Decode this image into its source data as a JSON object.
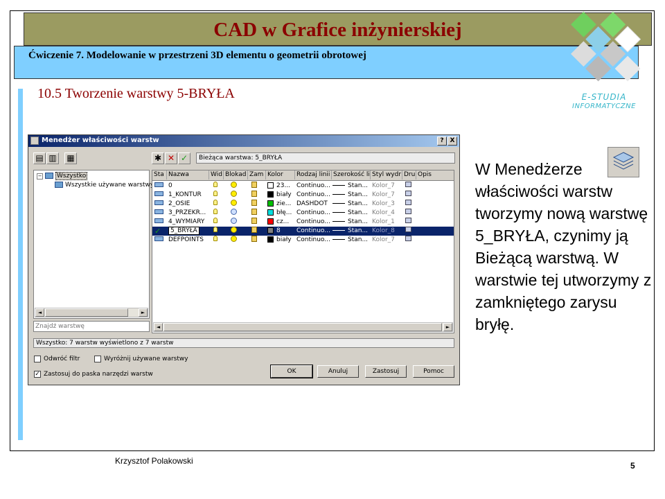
{
  "slide": {
    "title": "CAD w Grafice inżynierskiej",
    "subtitle": "Ćwiczenie 7. Modelowanie w przestrzeni 3D elementu o geometrii obrotowej",
    "section_heading": "10.5 Tworzenie warstwy 5-BRYŁA",
    "logo": {
      "line1": "E-STUDIA",
      "line2": "INFORMATYCZNE"
    },
    "body_text": "W Menedżerze właściwości warstw tworzymy nową warstwę 5_BRYŁA, czynimy ją Bieżącą warstwą. W warstwie tej utworzymy z zamkniętego zarysu bryłę.",
    "footer_author": "Krzysztof Polakowski",
    "page_number": "5",
    "colors": {
      "title": "#8b0000",
      "title_bar": "#9b9b61",
      "subtitle_bar": "#7fcfff",
      "logo": "#35b5c9"
    }
  },
  "dialog": {
    "title": "Menedżer właściwości warstw",
    "title_buttons": {
      "help": "?",
      "close": "X"
    },
    "current_layer": "Bieżąca warstwa: 5_BRYŁA",
    "tree": {
      "root": "Wszystko",
      "child": "Wszystkie używane warstwy"
    },
    "search_placeholder": "Znajdź warstwę",
    "columns": [
      "Sta",
      "Nazwa",
      "Wid",
      "Blokad",
      "Zam",
      "Kolor",
      "Rodzaj linii",
      "Szerokość li",
      "Styl wydr",
      "Dru",
      "Opis"
    ],
    "rows": [
      {
        "name": "0",
        "color_name": "23...",
        "color_hex": "#ffffff",
        "linetype": "Continuo...",
        "lineweight": "Stan...",
        "plot_style": "Kolor_7",
        "current": false,
        "frozen": false
      },
      {
        "name": "1_KONTUR",
        "color_name": "biały",
        "color_hex": "#000000",
        "linetype": "Continuo...",
        "lineweight": "Stan...",
        "plot_style": "Kolor_7",
        "current": false,
        "frozen": false
      },
      {
        "name": "2_OSIE",
        "color_name": "zie...",
        "color_hex": "#00c000",
        "linetype": "DASHDOT",
        "lineweight": "Stan...",
        "plot_style": "Kolor_3",
        "current": false,
        "frozen": false
      },
      {
        "name": "3_PRZEKR...",
        "color_name": "błę...",
        "color_hex": "#00e0e0",
        "linetype": "Continuo...",
        "lineweight": "Stan...",
        "plot_style": "Kolor_4",
        "current": false,
        "frozen": true
      },
      {
        "name": "4_WYMIARY",
        "color_name": "cz...",
        "color_hex": "#ff0000",
        "linetype": "Continuo...",
        "lineweight": "Stan...",
        "plot_style": "Kolor_1",
        "current": false,
        "frozen": true
      },
      {
        "name": "5_BRYŁA",
        "color_name": "8",
        "color_hex": "#808080",
        "linetype": "Continuo...",
        "lineweight": "Stan...",
        "plot_style": "Kolor_8",
        "current": true,
        "frozen": false
      },
      {
        "name": "DEFPOINTS",
        "color_name": "biały",
        "color_hex": "#000000",
        "linetype": "Continuo...",
        "lineweight": "Stan...",
        "plot_style": "Kolor_7",
        "current": false,
        "frozen": false
      }
    ],
    "status_text": "Wszystko: 7 warstw wyświetlono z 7 warstw",
    "checkboxes": [
      {
        "label": "Odwróć filtr",
        "checked": false
      },
      {
        "label": "Wyróżnij używane warstwy",
        "checked": false
      },
      {
        "label": "Zastosuj do paska narzędzi warstw",
        "checked": true
      }
    ],
    "buttons": {
      "ok": "OK",
      "cancel": "Anuluj",
      "apply": "Zastosuj",
      "help": "Pomoc"
    }
  }
}
